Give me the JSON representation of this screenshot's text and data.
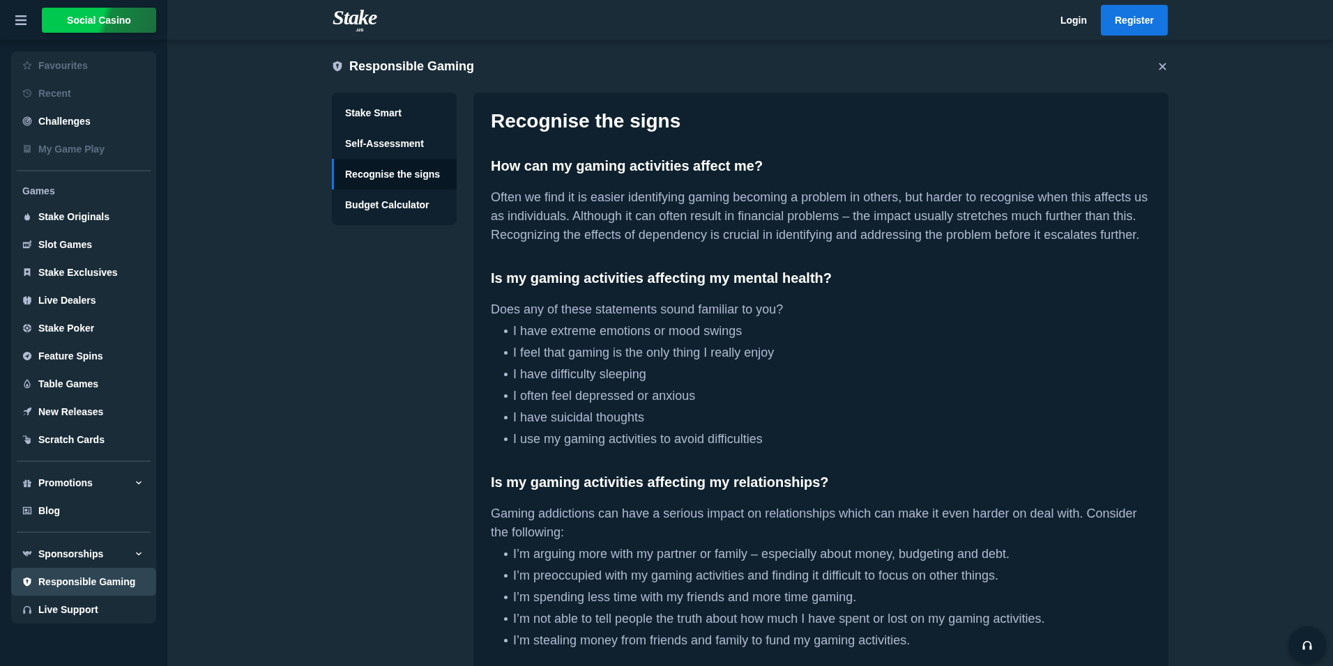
{
  "sidebar": {
    "casino_button": "Social Casino",
    "sections": [
      {
        "items": [
          {
            "label": "Favourites",
            "kind": "link",
            "disabled": true,
            "selected": false
          },
          {
            "label": "Recent",
            "kind": "link",
            "disabled": true,
            "selected": false
          },
          {
            "label": "Challenges",
            "kind": "link",
            "disabled": false,
            "selected": false
          },
          {
            "label": "My Game Play",
            "kind": "link",
            "disabled": true,
            "selected": false
          }
        ]
      },
      {
        "heading": "Games",
        "items": [
          {
            "label": "Stake Originals",
            "kind": "link",
            "disabled": false,
            "selected": false
          },
          {
            "label": "Slot Games",
            "kind": "link",
            "disabled": false,
            "selected": false
          },
          {
            "label": "Stake Exclusives",
            "kind": "link",
            "disabled": false,
            "selected": false
          },
          {
            "label": "Live Dealers",
            "kind": "link",
            "disabled": false,
            "selected": false
          },
          {
            "label": "Stake Poker",
            "kind": "link",
            "disabled": false,
            "selected": false
          },
          {
            "label": "Feature Spins",
            "kind": "link",
            "disabled": false,
            "selected": false
          },
          {
            "label": "Table Games",
            "kind": "link",
            "disabled": false,
            "selected": false
          },
          {
            "label": "New Releases",
            "kind": "link",
            "disabled": false,
            "selected": false
          },
          {
            "label": "Scratch Cards",
            "kind": "link",
            "disabled": false,
            "selected": false
          }
        ]
      },
      {
        "items": [
          {
            "label": "Promotions",
            "kind": "menu",
            "expanded": false,
            "disabled": false,
            "selected": false
          },
          {
            "label": "Blog",
            "kind": "link",
            "disabled": false,
            "selected": false
          }
        ]
      },
      {
        "items": [
          {
            "label": "Sponsorships",
            "kind": "menu",
            "expanded": false,
            "disabled": false,
            "selected": false
          },
          {
            "label": "Responsible Gaming",
            "kind": "link",
            "disabled": false,
            "selected": true
          },
          {
            "label": "Live Support",
            "kind": "link",
            "disabled": false,
            "selected": false
          }
        ]
      }
    ]
  },
  "header": {
    "logo": {
      "wordmark": "Stake",
      "suffix": ".us"
    },
    "buttons": [
      {
        "label": "Login",
        "kind": "text"
      },
      {
        "label": "Register",
        "kind": "primary"
      }
    ]
  },
  "page": {
    "title": "Responsible Gaming",
    "nav": [
      {
        "label": "Stake Smart",
        "selected": false
      },
      {
        "label": "Self-Assessment",
        "selected": false
      },
      {
        "label": "Recognise the signs",
        "selected": true
      },
      {
        "label": "Budget Calculator",
        "selected": false
      }
    ],
    "article": {
      "title": "Recognise the signs",
      "sections": [
        {
          "heading": "How can my gaming activities affect me?",
          "blocks": [
            {
              "kind": "paragraph",
              "text": "Often we find it is easier identifying gaming becoming a problem in others, but harder to recognise when this affects us as individuals. Although it can often result in financial problems – the impact usually stretches much further than this. Recognizing the effects of dependency is crucial in identifying and addressing the problem before it escalates further."
            }
          ]
        },
        {
          "heading": "Is my gaming activities affecting my mental health?",
          "blocks": [
            {
              "kind": "paragraph",
              "text": "Does any of these statements sound familiar to you?"
            },
            {
              "kind": "list",
              "items": [
                "I have extreme emotions or mood swings",
                "I feel that gaming is the only thing I really enjoy",
                "I have difficulty sleeping",
                "I often feel depressed or anxious",
                "I have suicidal thoughts",
                "I use my gaming activities to avoid difficulties"
              ]
            }
          ]
        },
        {
          "heading": "Is my gaming activities affecting my relationships?",
          "blocks": [
            {
              "kind": "paragraph",
              "text": "Gaming addictions can have a serious impact on relationships which can make it even harder on deal with. Consider the following:"
            },
            {
              "kind": "list",
              "items": [
                "I’m arguing more with my partner or family – especially about money, budgeting and debt.",
                "I’m preoccupied with my gaming activities and finding it difficult to focus on other things.",
                "I’m spending less time with my friends and more time gaming.",
                "I’m not able to tell people the truth about how much I have spent or lost on my gaming activities.",
                "I’m stealing money from friends and family to fund my gaming activities."
              ]
            }
          ]
        }
      ]
    }
  }
}
